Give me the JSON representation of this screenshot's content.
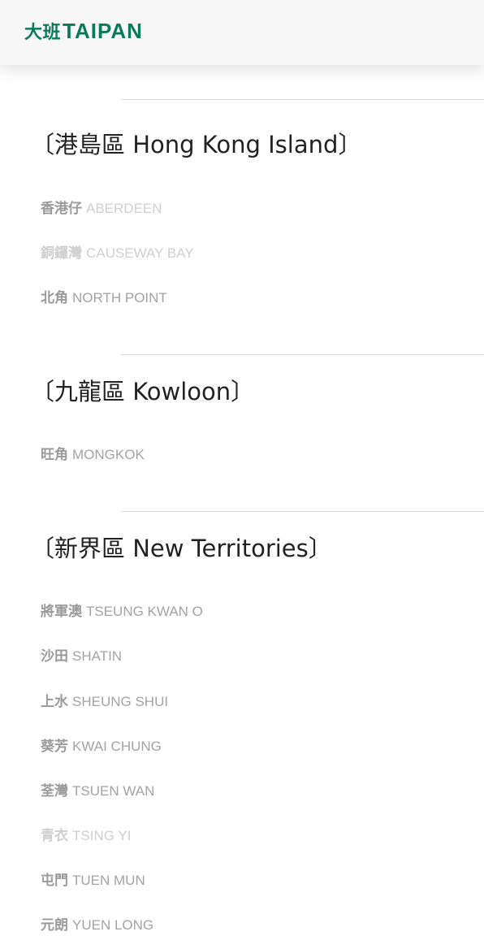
{
  "header": {
    "logo_cn": "大班",
    "logo_en": "TAIPAN",
    "brand_color": "#0a7a58"
  },
  "sections": [
    {
      "title": "〔港島區 Hong Kong Island〕",
      "items": [
        {
          "zh": "香港仔",
          "en": "ABERDEEN"
        },
        {
          "zh": "銅鑼灣",
          "en": "CAUSEWAY BAY"
        },
        {
          "zh": "北角",
          "en": "NORTH POINT"
        }
      ]
    },
    {
      "title": "〔九龍區 Kowloon〕",
      "items": [
        {
          "zh": "旺角",
          "en": "MONGKOK"
        }
      ]
    },
    {
      "title": "〔新界區 New Territories〕",
      "items": [
        {
          "zh": "將軍澳",
          "en": "TSEUNG KWAN O"
        },
        {
          "zh": "沙田",
          "en": "SHATIN"
        },
        {
          "zh": "上水",
          "en": "SHEUNG SHUI"
        },
        {
          "zh": "葵芳",
          "en": "KWAI CHUNG"
        },
        {
          "zh": "荃灣",
          "en": "TSUEN WAN"
        },
        {
          "zh": "青衣",
          "en": "TSING YI"
        },
        {
          "zh": "屯門",
          "en": "TUEN MUN"
        },
        {
          "zh": "元朗",
          "en": "YUEN LONG"
        }
      ]
    }
  ]
}
